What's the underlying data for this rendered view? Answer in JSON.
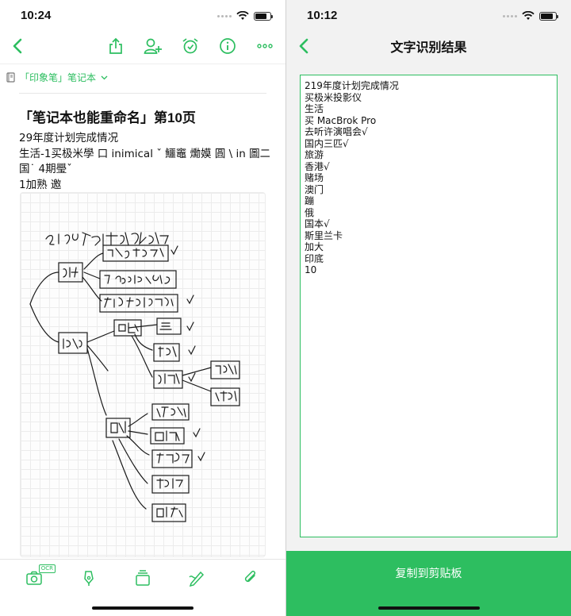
{
  "left": {
    "status": {
      "time": "10:24",
      "battery_level": 0.7
    },
    "nav": {
      "back_icon": "chevron-left-icon",
      "actions": [
        "share-icon",
        "add-user-icon",
        "alarm-icon",
        "info-icon",
        "more-icon"
      ]
    },
    "notebook": {
      "name": "「印象笔」笔记本",
      "icon": "notebook-icon",
      "chevron": "chevron-down-icon"
    },
    "note": {
      "title": "「笔记本也能重命名」第10页",
      "lines": [
        "29年度计划完成情况",
        "生活-1买极米學 口 inimical ˇ 鱷竈 爋嫫 圓 \\ in 圖二",
        "国˙ 4期璺ˇ",
        "1加熟 邀"
      ]
    },
    "toolbar": {
      "items": [
        "camera-ocr-icon",
        "pen-icon",
        "stack-icon",
        "sketch-icon",
        "attachment-icon"
      ],
      "ocr_badge": "OCR"
    }
  },
  "right": {
    "status": {
      "time": "10:12",
      "battery_level": 0.75
    },
    "title": "文字识别结果",
    "ocr_lines": [
      "219年度计划完成情况",
      "买极米投影仪",
      "生活",
      "买 MacBrok Pro",
      "去听许演唱会√",
      "国内三匹√",
      "旅游",
      "香港√",
      "赌场",
      "澳门",
      "蹦",
      "俄",
      "国本√",
      "斯里兰卡",
      "加大",
      "印底",
      "10"
    ],
    "copy_button": "复制到剪贴板"
  },
  "colors": {
    "accent": "#2dbe60",
    "ink": "#1a1a1a"
  }
}
